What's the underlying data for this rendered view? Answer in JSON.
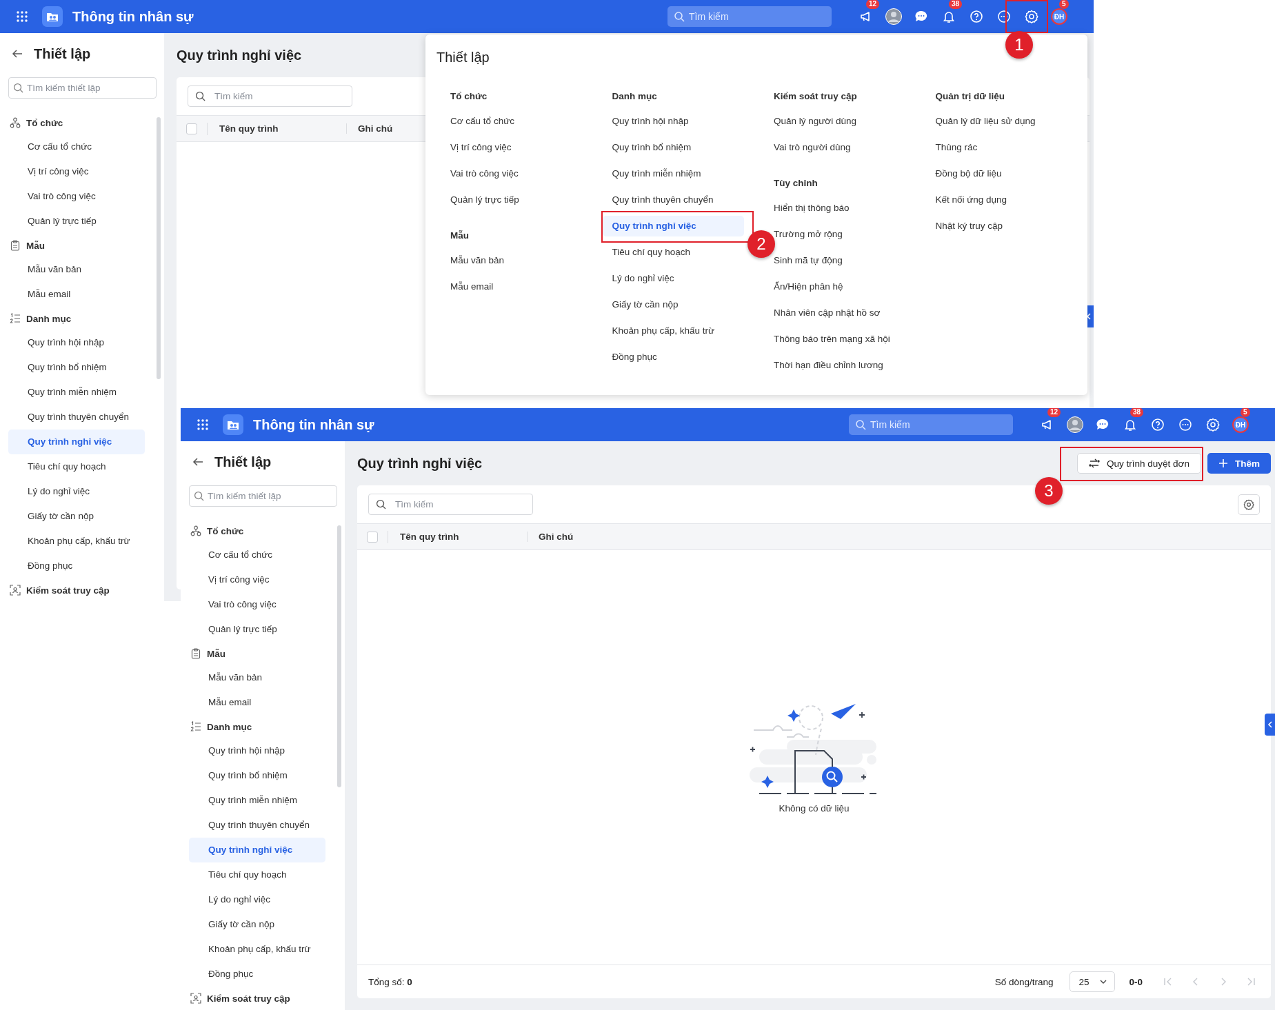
{
  "screens": [
    {
      "header": {
        "app_title": "Thông tin nhân sự",
        "search_placeholder": "Tìm kiếm",
        "actions": [
          {
            "kind": "announce",
            "badge": "12"
          },
          {
            "kind": "photo"
          },
          {
            "kind": "chat"
          },
          {
            "kind": "bell",
            "badge": "38"
          },
          {
            "kind": "help"
          },
          {
            "kind": "more"
          },
          {
            "kind": "settings"
          },
          {
            "kind": "avatar",
            "initials": "ĐH",
            "badge": "5"
          }
        ]
      },
      "sidebar": {
        "title": "Thiết lập",
        "search_placeholder": "Tìm kiếm thiết lập",
        "groups": [
          {
            "kind": "org",
            "label": "Tổ chức",
            "children": [
              {
                "label": "Cơ cấu tổ chức",
                "selected": false
              },
              {
                "label": "Vị trí công việc",
                "selected": false
              },
              {
                "label": "Vai trò công việc",
                "selected": false
              },
              {
                "label": "Quản lý trực tiếp",
                "selected": false
              }
            ]
          },
          {
            "kind": "template",
            "label": "Mẫu",
            "children": [
              {
                "label": "Mẫu văn bản",
                "selected": false
              },
              {
                "label": "Mẫu email",
                "selected": false
              }
            ]
          },
          {
            "kind": "list",
            "label": "Danh mục",
            "children": [
              {
                "label": "Quy trình hội nhập",
                "selected": false
              },
              {
                "label": "Quy trình bổ nhiệm",
                "selected": false
              },
              {
                "label": "Quy trình miễn nhiệm",
                "selected": false
              },
              {
                "label": "Quy trình thuyên chuyển",
                "selected": false
              },
              {
                "label": "Quy trình nghỉ việc",
                "selected": true
              },
              {
                "label": "Tiêu chí quy hoạch",
                "selected": false
              },
              {
                "label": "Lý do nghỉ việc",
                "selected": false
              },
              {
                "label": "Giấy tờ cần nộp",
                "selected": false
              },
              {
                "label": "Khoản phụ cấp, khấu trừ",
                "selected": false
              },
              {
                "label": "Đồng phục",
                "selected": false
              }
            ]
          },
          {
            "kind": "access",
            "label": "Kiểm soát truy cập"
          }
        ]
      },
      "page": {
        "title": "Quy trình nghỉ việc",
        "search_placeholder": "Tìm kiếm",
        "select_all_checked": false,
        "columns": [
          "Tên quy trình",
          "Ghi chú"
        ]
      },
      "settings_menu": {
        "title": "Thiết lập",
        "columns": [
          [
            {
              "heading": "Tổ chức",
              "items": [
                {
                  "label": "Cơ cấu tổ chức",
                  "selected": false
                },
                {
                  "label": "Vị trí công việc",
                  "selected": false
                },
                {
                  "label": "Vai trò công việc",
                  "selected": false
                },
                {
                  "label": "Quản lý trực tiếp",
                  "selected": false
                }
              ]
            },
            {
              "heading": "Mẫu",
              "items": [
                {
                  "label": "Mẫu văn bản",
                  "selected": false
                },
                {
                  "label": "Mẫu email",
                  "selected": false
                }
              ]
            }
          ],
          [
            {
              "heading": "Danh mục",
              "items": [
                {
                  "label": "Quy trình hội nhập",
                  "selected": false
                },
                {
                  "label": "Quy trình bổ nhiệm",
                  "selected": false
                },
                {
                  "label": "Quy trình miễn nhiệm",
                  "selected": false
                },
                {
                  "label": "Quy trình thuyên chuyển",
                  "selected": false
                },
                {
                  "label": "Quy trình nghỉ việc",
                  "selected": true
                },
                {
                  "label": "Tiêu chí quy hoạch",
                  "selected": false
                },
                {
                  "label": "Lý do nghỉ việc",
                  "selected": false
                },
                {
                  "label": "Giấy tờ cần nộp",
                  "selected": false
                },
                {
                  "label": "Khoản phụ cấp, khấu trừ",
                  "selected": false
                },
                {
                  "label": "Đồng phục",
                  "selected": false
                }
              ]
            }
          ],
          [
            {
              "heading": "Kiểm soát truy cập",
              "items": [
                {
                  "label": "Quản lý người dùng",
                  "selected": false
                },
                {
                  "label": "Vai trò người dùng",
                  "selected": false
                }
              ]
            },
            {
              "heading": "Tùy chỉnh",
              "items": [
                {
                  "label": "Hiển thị thông báo",
                  "selected": false
                },
                {
                  "label": "Trường mở rộng",
                  "selected": false
                },
                {
                  "label": "Sinh mã tự động",
                  "selected": false
                },
                {
                  "label": "Ẩn/Hiện phân hệ",
                  "selected": false
                },
                {
                  "label": "Nhân viên cập nhật hồ sơ",
                  "selected": false
                },
                {
                  "label": "Thông báo trên mạng xã hội",
                  "selected": false
                },
                {
                  "label": "Thời hạn điều chỉnh lương",
                  "selected": false
                }
              ]
            }
          ],
          [
            {
              "heading": "Quản trị dữ liệu",
              "items": [
                {
                  "label": "Quản lý dữ liệu sử dụng",
                  "selected": false
                },
                {
                  "label": "Thùng rác",
                  "selected": false
                },
                {
                  "label": "Đồng bộ dữ liệu",
                  "selected": false
                },
                {
                  "label": "Kết nối ứng dụng",
                  "selected": false
                },
                {
                  "label": "Nhật ký truy cập",
                  "selected": false
                }
              ]
            }
          ]
        ]
      }
    },
    {
      "header": {
        "app_title": "Thông tin nhân sự",
        "search_placeholder": "Tìm kiếm",
        "actions": [
          {
            "kind": "announce",
            "badge": "12"
          },
          {
            "kind": "photo"
          },
          {
            "kind": "chat"
          },
          {
            "kind": "bell",
            "badge": "38"
          },
          {
            "kind": "help"
          },
          {
            "kind": "more"
          },
          {
            "kind": "settings"
          },
          {
            "kind": "avatar",
            "initials": "ĐH",
            "badge": "5"
          }
        ]
      },
      "sidebar": {
        "title": "Thiết lập",
        "search_placeholder": "Tìm kiếm thiết lập",
        "groups": [
          {
            "kind": "org",
            "label": "Tổ chức",
            "children": [
              {
                "label": "Cơ cấu tổ chức",
                "selected": false
              },
              {
                "label": "Vị trí công việc",
                "selected": false
              },
              {
                "label": "Vai trò công việc",
                "selected": false
              },
              {
                "label": "Quản lý trực tiếp",
                "selected": false
              }
            ]
          },
          {
            "kind": "template",
            "label": "Mẫu",
            "children": [
              {
                "label": "Mẫu văn bản",
                "selected": false
              },
              {
                "label": "Mẫu email",
                "selected": false
              }
            ]
          },
          {
            "kind": "list",
            "label": "Danh mục",
            "children": [
              {
                "label": "Quy trình hội nhập",
                "selected": false
              },
              {
                "label": "Quy trình bổ nhiệm",
                "selected": false
              },
              {
                "label": "Quy trình miễn nhiệm",
                "selected": false
              },
              {
                "label": "Quy trình thuyên chuyển",
                "selected": false
              },
              {
                "label": "Quy trình nghỉ việc",
                "selected": true
              },
              {
                "label": "Tiêu chí quy hoạch",
                "selected": false
              },
              {
                "label": "Lý do nghỉ việc",
                "selected": false
              },
              {
                "label": "Giấy tờ cần nộp",
                "selected": false
              },
              {
                "label": "Khoản phụ cấp, khấu trừ",
                "selected": false
              },
              {
                "label": "Đồng phục",
                "selected": false
              }
            ]
          },
          {
            "kind": "access",
            "label": "Kiểm soát truy cập"
          }
        ]
      },
      "page": {
        "title": "Quy trình nghỉ việc",
        "search_placeholder": "Tìm kiếm",
        "select_all_checked": false,
        "columns": [
          "Tên quy trình",
          "Ghi chú"
        ],
        "buttons": [
          {
            "kind": "secondary",
            "label": "Quy trình duyệt đơn"
          },
          {
            "kind": "primary",
            "label": "Thêm"
          }
        ],
        "empty_text": "Không có dữ liệu",
        "footer": {
          "total_label": "Tổng số:",
          "total": "0",
          "rows_label": "Số dòng/trang",
          "page_size": "25",
          "range": "0-0"
        }
      }
    }
  ],
  "annotations": [
    {
      "label": "1"
    },
    {
      "label": "2"
    },
    {
      "label": "3"
    }
  ]
}
